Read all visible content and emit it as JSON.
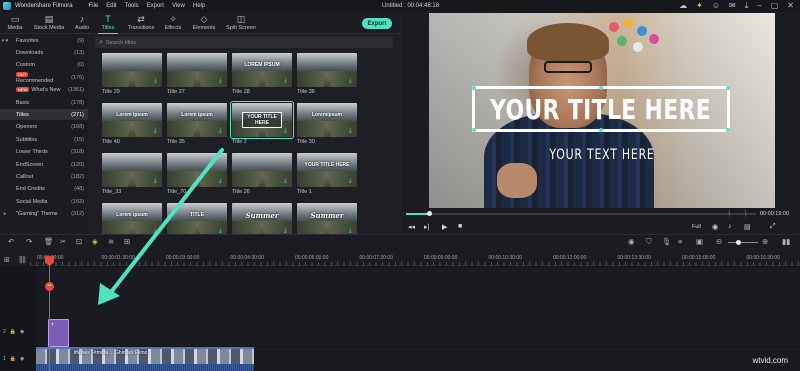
{
  "app": {
    "name": "Wondershare Filmora",
    "menu": [
      "File",
      "Edit",
      "Tools",
      "Export",
      "View",
      "Help"
    ],
    "project": "Untitled : 00:04:48:18"
  },
  "toolbar": {
    "tabs": [
      {
        "label": "Media",
        "icon": "folder-icon"
      },
      {
        "label": "Stock Media",
        "icon": "stock-media-icon"
      },
      {
        "label": "Audio",
        "icon": "music-note-icon"
      },
      {
        "label": "Titles",
        "icon": "text-icon",
        "active": true
      },
      {
        "label": "Transitions",
        "icon": "transition-icon"
      },
      {
        "label": "Effects",
        "icon": "effects-icon"
      },
      {
        "label": "Elements",
        "icon": "elements-icon"
      },
      {
        "label": "Split Screen",
        "icon": "split-screen-icon"
      }
    ],
    "export_label": "Export"
  },
  "sidebar": {
    "items": [
      {
        "label": "Favorites",
        "count": "(9)",
        "prefix": "▾ ♥"
      },
      {
        "label": "Downloads",
        "count": "(13)"
      },
      {
        "label": "Custom",
        "count": "(0)"
      },
      {
        "label": "Recommended",
        "count": "(176)",
        "badge": "HOT"
      },
      {
        "label": "What's New",
        "count": "(1361)",
        "badge": "NEW"
      },
      {
        "label": "Basic",
        "count": "(178)"
      },
      {
        "label": "Titles",
        "count": "(271)",
        "selected": true
      },
      {
        "label": "Openers",
        "count": "(168)"
      },
      {
        "label": "Subtitles",
        "count": "(15)"
      },
      {
        "label": "Lower Thirds",
        "count": "(318)"
      },
      {
        "label": "EndScreen",
        "count": "(120)"
      },
      {
        "label": "Callout",
        "count": "(182)"
      },
      {
        "label": "End Credits",
        "count": "(48)"
      },
      {
        "label": "Social Media",
        "count": "(162)"
      },
      {
        "label": "\"Gaming\" Theme",
        "count": "(312)",
        "prefix": "▸"
      }
    ]
  },
  "search": {
    "placeholder": "Search titles"
  },
  "grid": {
    "items": [
      {
        "label": "Title 29",
        "overlay": "",
        "style": "plain"
      },
      {
        "label": "Title 27",
        "overlay": "",
        "style": "plain"
      },
      {
        "label": "Title 28",
        "overlay": "LOREM IPSUM",
        "style": "plain"
      },
      {
        "label": "Title 38",
        "overlay": "",
        "style": "plain"
      },
      {
        "label": "Title 40",
        "overlay": "Lorem ipsum",
        "style": "plain"
      },
      {
        "label": "Title 35",
        "overlay": "Lorem ipsum",
        "style": "plain"
      },
      {
        "label": "Title 2",
        "overlay": "YOUR TITLE HERE",
        "style": "boxed",
        "selected": true
      },
      {
        "label": "Title 30",
        "overlay": "Loremipsum",
        "style": "plain"
      },
      {
        "label": "Title_33",
        "overlay": "",
        "style": "plain"
      },
      {
        "label": "Title_70",
        "overlay": "",
        "style": "plain"
      },
      {
        "label": "Title 26",
        "overlay": "",
        "style": "plain"
      },
      {
        "label": "Title 1",
        "overlay": "YOUR TITLE HERE",
        "style": "plain"
      },
      {
        "label": "",
        "overlay": "Lorem ipsum",
        "style": "plain"
      },
      {
        "label": "",
        "overlay": "TITLE",
        "style": "plain"
      },
      {
        "label": "",
        "overlay": "Summer",
        "style": "script"
      },
      {
        "label": "",
        "overlay": "Summer",
        "style": "script"
      }
    ]
  },
  "preview": {
    "title_main": "YOUR TITLE HERE",
    "title_sub": "YOUR TEXT HERE",
    "timecode": "00:00:19:00",
    "quality": "Full",
    "progress": 0.065
  },
  "timeline": {
    "ruler": [
      "00:00:00:00",
      "00:00:01:30:00",
      "00:00:03:00:00",
      "00:00:04:30:00",
      "00:00:06:00:00",
      "00:00:07:30:00",
      "00:00:09:00:00",
      "00:00:10:30:00",
      "00:00:12:00:00",
      "00:00:13:30:00",
      "00:00:15:00:00",
      "00:00:16:30:00"
    ],
    "title_clip_label": "T",
    "video_clip_label": "iffenies Fitmora ... Ghindes Filmo",
    "tracks": [
      {
        "number": "2"
      },
      {
        "number": "1"
      }
    ]
  },
  "watermark": "wtvid.com",
  "colors": {
    "accent": "#4fe3c1",
    "playhead": "#e7473c",
    "title_clip": "#7c5db3"
  }
}
